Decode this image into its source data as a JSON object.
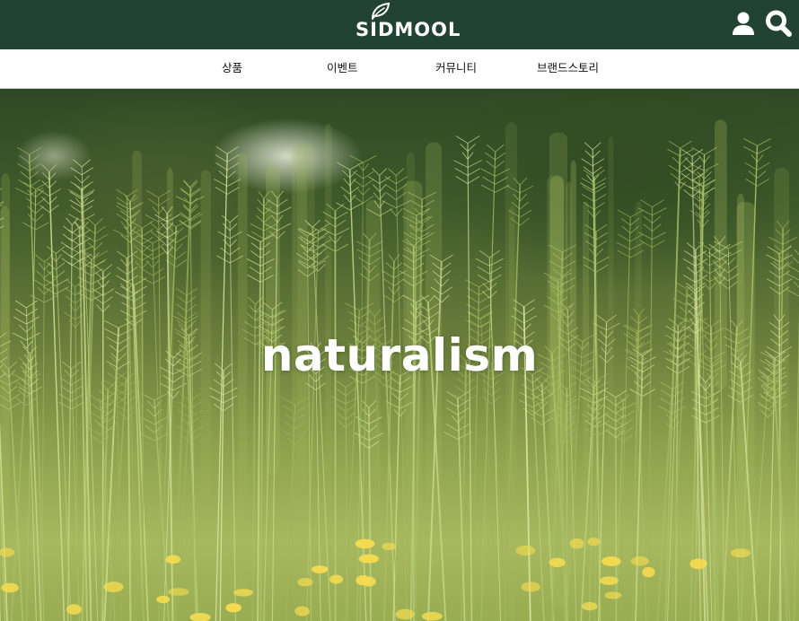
{
  "header": {
    "brand": "SIDMOOL",
    "background_color": "#224234",
    "icons": [
      "leaf-icon",
      "user-icon",
      "search-icon"
    ]
  },
  "nav": {
    "items": [
      {
        "label": "상품"
      },
      {
        "label": "이벤트"
      },
      {
        "label": "커뮤니티"
      },
      {
        "label": "브랜드스토리"
      }
    ]
  },
  "hero": {
    "headline": "naturalism"
  }
}
